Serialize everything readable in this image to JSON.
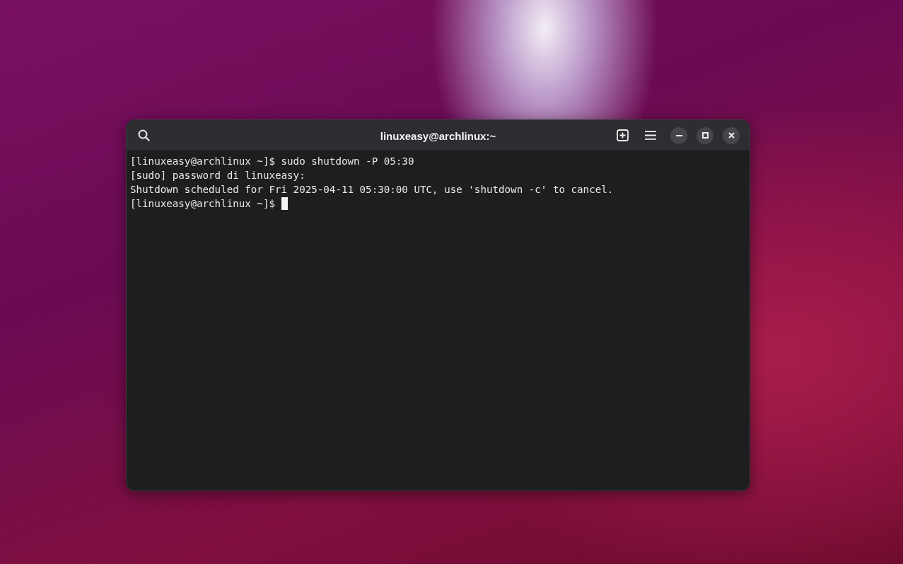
{
  "window": {
    "title": "linuxeasy@archlinux:~"
  },
  "terminal": {
    "lines": [
      {
        "text": "[linuxeasy@archlinux ~]$ sudo shutdown -P 05:30",
        "cursor": false
      },
      {
        "text": "[sudo] password di linuxeasy:",
        "cursor": false
      },
      {
        "text": "Shutdown scheduled for Fri 2025-04-11 05:30:00 UTC, use 'shutdown -c' to cancel.",
        "cursor": false
      },
      {
        "text": "[linuxeasy@archlinux ~]$ ",
        "cursor": true
      }
    ]
  }
}
